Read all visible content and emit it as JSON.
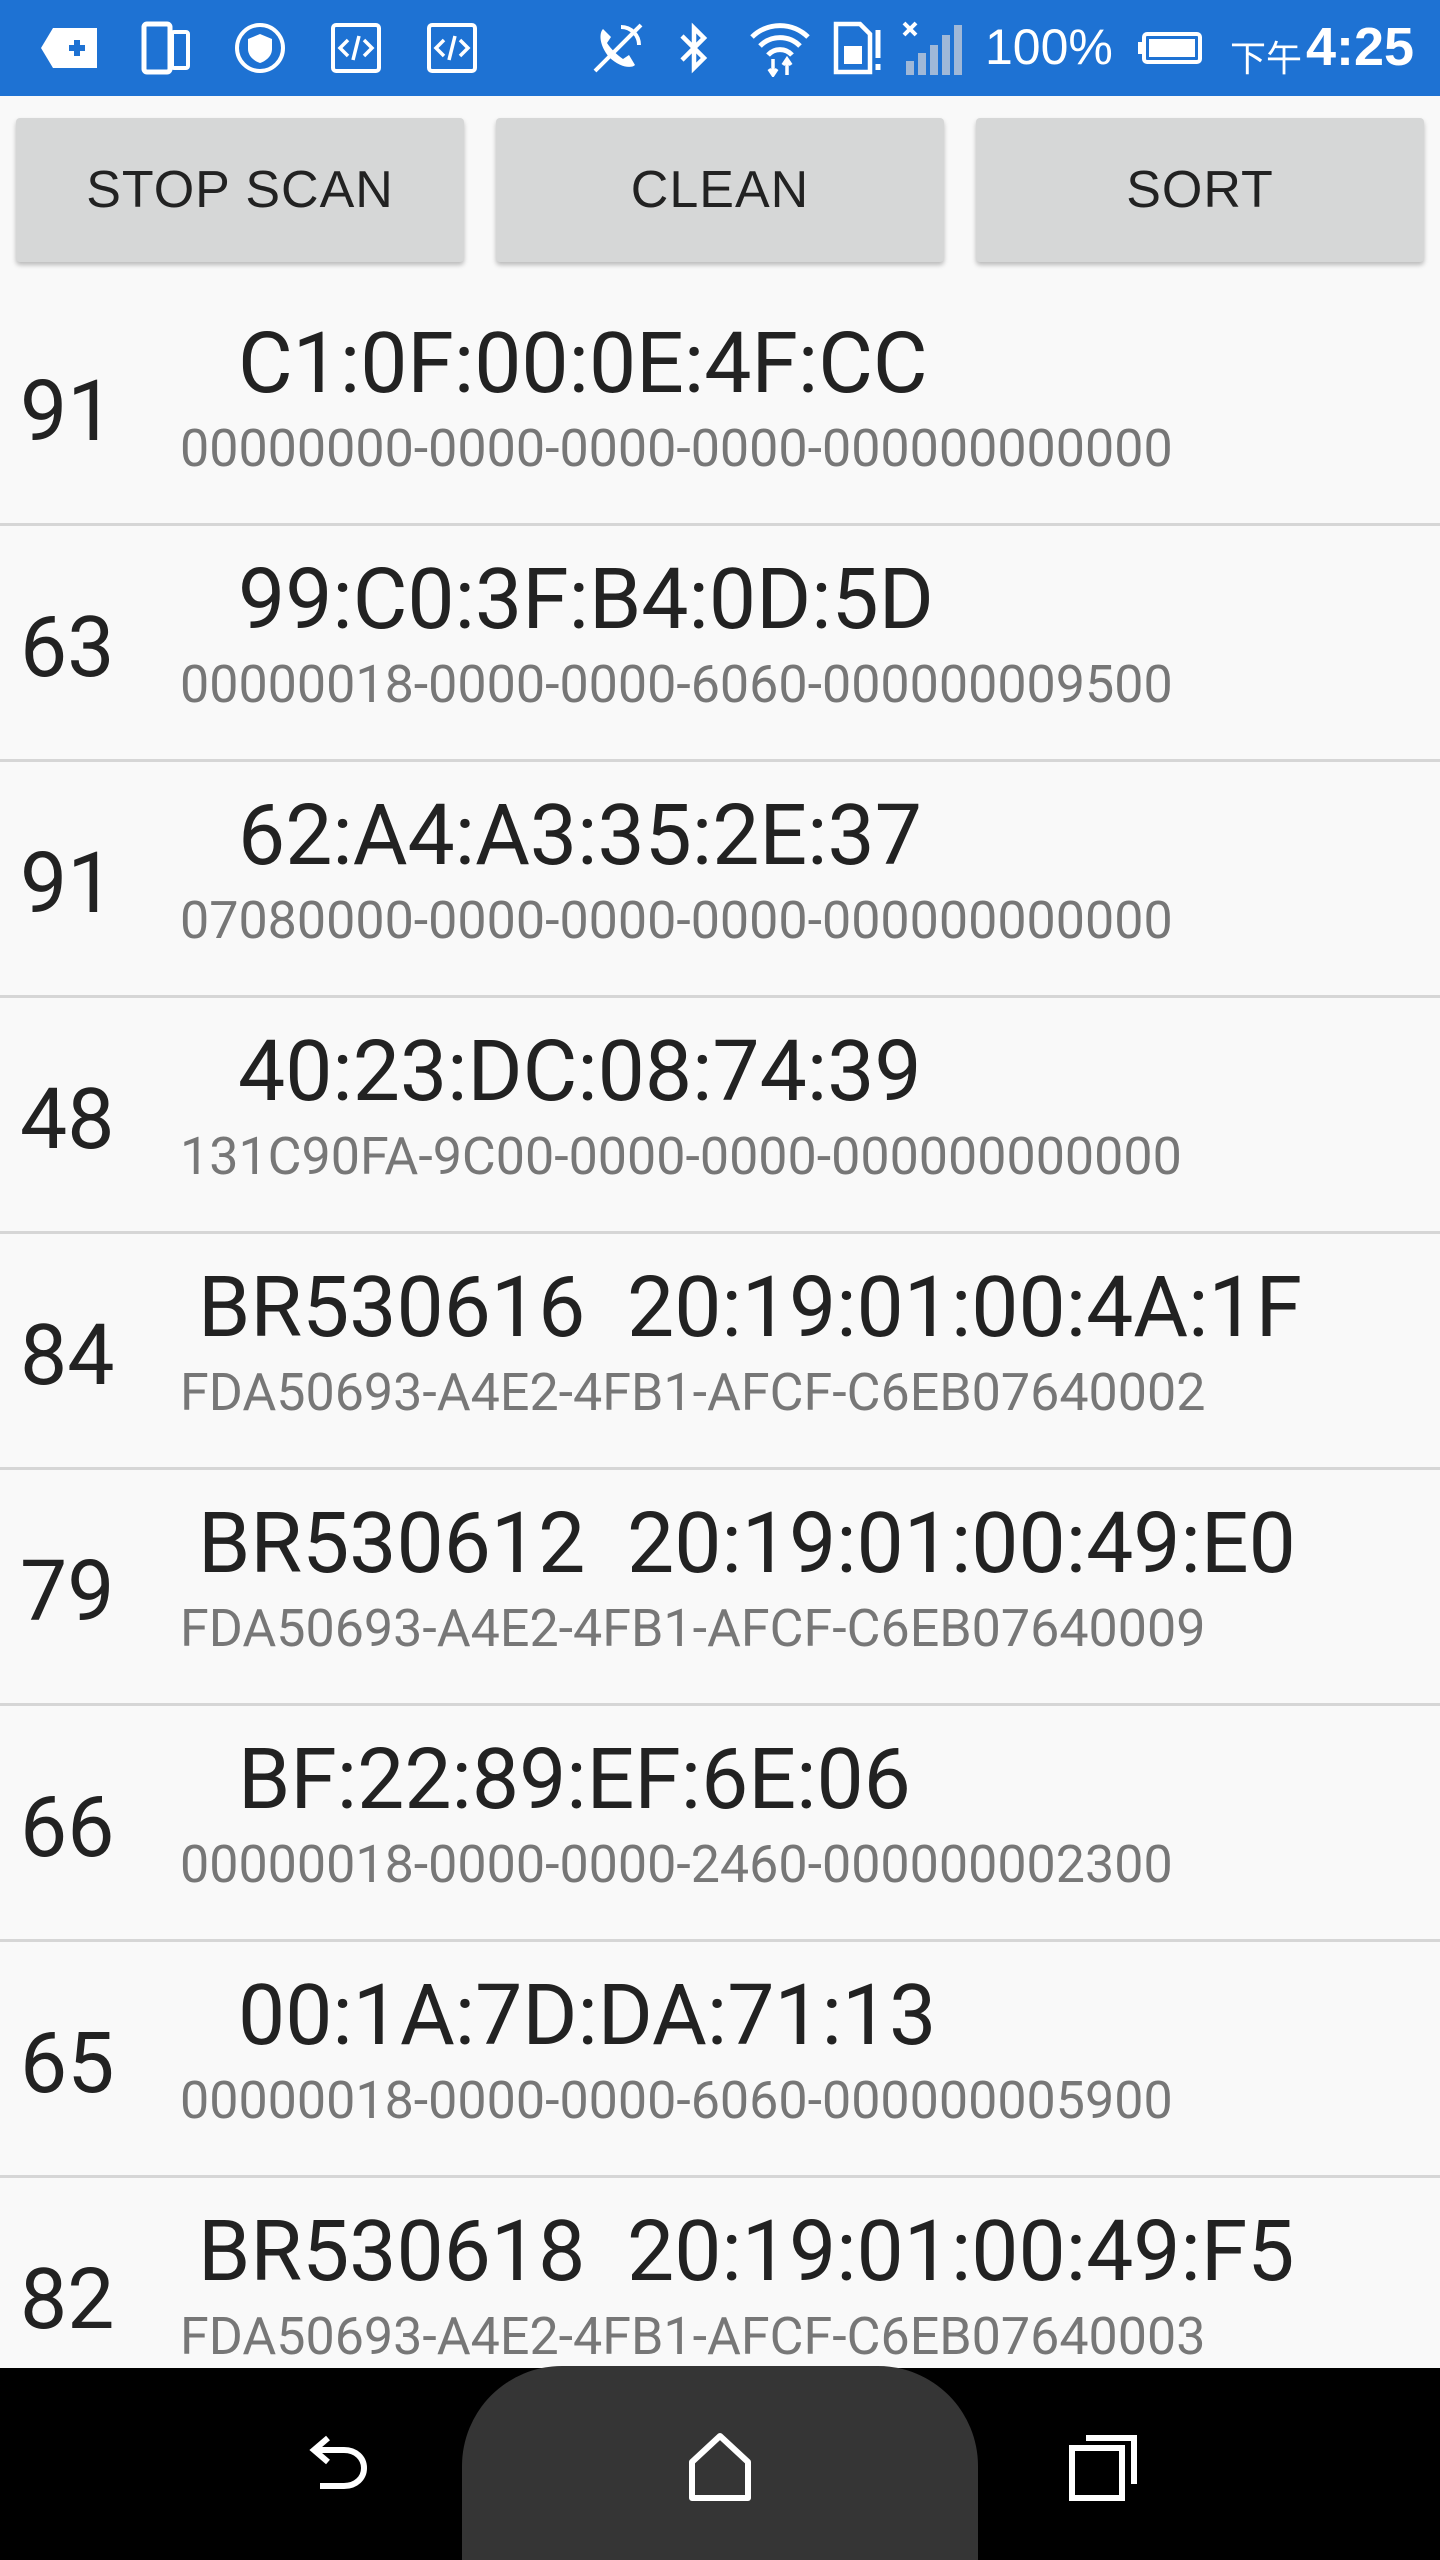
{
  "status_bar": {
    "battery_percent": "100%",
    "time_prefix": "下午",
    "time": "4:25",
    "icons": [
      "add-box-icon",
      "phone-tablet-icon",
      "shield-icon",
      "code-icon",
      "code-icon",
      "no-call-icon",
      "bluetooth-icon",
      "wifi-icon",
      "sim-alert-icon",
      "no-signal-icon",
      "battery-icon"
    ],
    "color": "#1e72d3"
  },
  "toolbar": {
    "stop_scan_label": "STOP SCAN",
    "clean_label": "CLEAN",
    "sort_label": "SORT"
  },
  "devices": [
    {
      "rssi": "91",
      "title": "C1:0F:00:0E:4F:CC",
      "uuid": "00000000-0000-0000-0000-000000000000"
    },
    {
      "rssi": "63",
      "title": "99:C0:3F:B4:0D:5D",
      "uuid": "00000018-0000-0000-6060-000000009500"
    },
    {
      "rssi": "91",
      "title": "62:A4:A3:35:2E:37",
      "uuid": "07080000-0000-0000-0000-000000000000"
    },
    {
      "rssi": "48",
      "title": "40:23:DC:08:74:39",
      "uuid": "131C90FA-9C00-0000-0000-000000000000"
    },
    {
      "rssi": "84",
      "title": "BR530616  20:19:01:00:4A:1F",
      "uuid": "FDA50693-A4E2-4FB1-AFCF-C6EB07640002"
    },
    {
      "rssi": "79",
      "title": "BR530612  20:19:01:00:49:E0",
      "uuid": "FDA50693-A4E2-4FB1-AFCF-C6EB07640009"
    },
    {
      "rssi": "66",
      "title": "BF:22:89:EF:6E:06",
      "uuid": "00000018-0000-0000-2460-000000002300"
    },
    {
      "rssi": "65",
      "title": "00:1A:7D:DA:71:13",
      "uuid": "00000018-0000-0000-6060-000000005900"
    },
    {
      "rssi": "82",
      "title": "BR530618  20:19:01:00:49:F5",
      "uuid": "FDA50693-A4E2-4FB1-AFCF-C6EB07640003"
    }
  ],
  "nav_bar": {
    "icons": [
      "back-icon",
      "home-icon",
      "recents-icon"
    ]
  }
}
